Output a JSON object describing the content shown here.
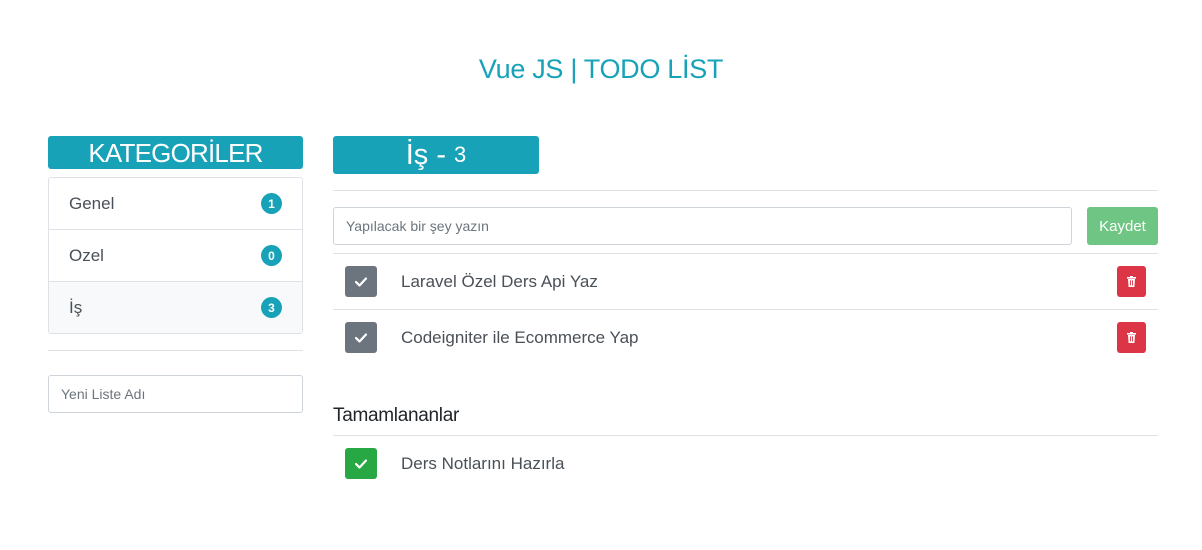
{
  "app": {
    "title": "Vue JS | TODO LİST"
  },
  "sidebar": {
    "header": "KATEGORİLER",
    "items": [
      {
        "label": "Genel",
        "count": "1"
      },
      {
        "label": "Ozel",
        "count": "0"
      },
      {
        "label": "İş",
        "count": "3"
      }
    ],
    "new_list_placeholder": "Yeni Liste Adı"
  },
  "main": {
    "list_title": "İş -",
    "list_count": "3",
    "input_placeholder": "Yapılacak bir şey yazın",
    "save_label": "Kaydet",
    "todos": [
      {
        "text": "Laravel Özel Ders Api Yaz"
      },
      {
        "text": "Codeigniter ile Ecommerce Yap"
      }
    ],
    "completed_title": "Tamamlananlar",
    "completed": [
      {
        "text": "Ders Notlarını Hazırla"
      }
    ]
  },
  "colors": {
    "accent": "#17a2b8",
    "success": "#28a745",
    "danger": "#dc3545",
    "secondary": "#6c757d"
  },
  "icons": {
    "check": "check-icon",
    "delete": "trash-icon"
  }
}
